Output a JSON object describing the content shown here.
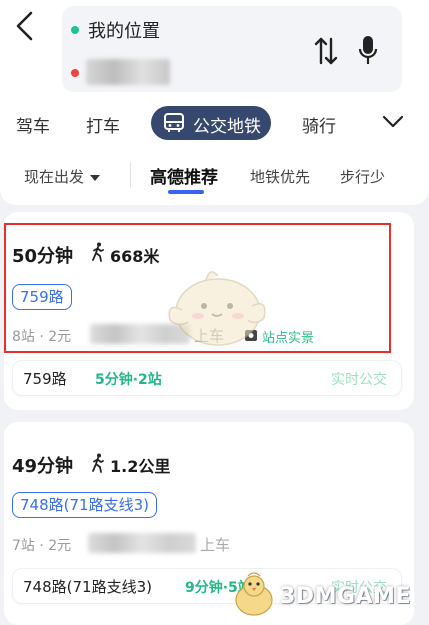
{
  "search": {
    "origin": "我的位置"
  },
  "modes": {
    "drive": "驾车",
    "taxi": "打车",
    "transit": "公交地铁",
    "ride": "骑行"
  },
  "filters": {
    "depart": "现在出发",
    "recommend": "高德推荐",
    "subway_first": "地铁优先",
    "less_walk": "步行少"
  },
  "routes": [
    {
      "duration": "50分钟",
      "walk": "668米",
      "tag": "759路",
      "stops_price": "8站 · 2元",
      "board": "上车",
      "photo": "站点实景",
      "line_name": "759路",
      "eta": "5分钟·2站",
      "realtime": "实时公交"
    },
    {
      "duration": "49分钟",
      "walk": "1.2公里",
      "tag": "748路(71路支线3)",
      "stops_price": "7站 · 2元",
      "board": "上车",
      "line_name": "748路(71路支线3)",
      "eta": "9分钟·5站",
      "realtime": "实时公交"
    }
  ],
  "watermark": "3DMGAME",
  "colors": {
    "accent": "#3a6df0",
    "active_mode": "#36486e",
    "green": "#23b884",
    "highlight": "#e8302f"
  }
}
